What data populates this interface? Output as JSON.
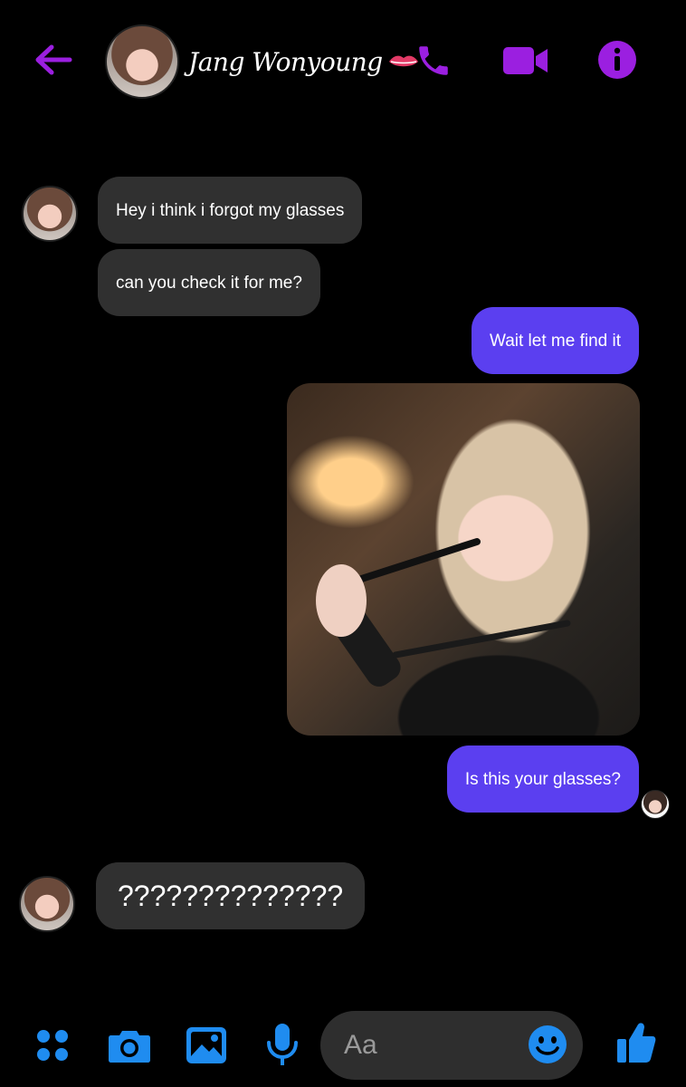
{
  "header": {
    "contact_name": "Jang Wonyoung",
    "accent_color": "#9b1fe0"
  },
  "messages": [
    {
      "direction": "incoming",
      "text": "Hey i think i forgot my glasses"
    },
    {
      "direction": "incoming",
      "text": "can you check it for me?"
    },
    {
      "direction": "outgoing",
      "text": "Wait let me find it"
    },
    {
      "direction": "outgoing",
      "type": "photo"
    },
    {
      "direction": "outgoing",
      "text": "Is this your glasses?"
    },
    {
      "direction": "incoming",
      "text": "??????????????"
    }
  ],
  "composer": {
    "placeholder": "Aa",
    "icons": [
      "apps-icon",
      "camera-icon",
      "gallery-icon",
      "microphone-icon",
      "emoji-icon",
      "thumbs-up-icon"
    ],
    "icon_color": "#1f8cf0"
  },
  "colors": {
    "background": "#000000",
    "incoming_bubble": "#303030",
    "outgoing_bubble": "#5b3ff0"
  }
}
